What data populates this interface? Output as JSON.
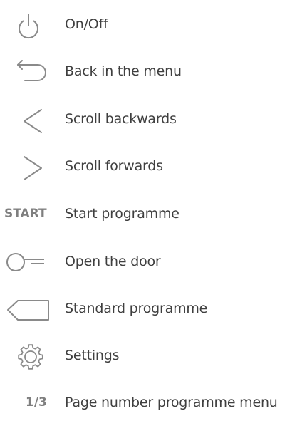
{
  "colors": {
    "icon": "#8a8a8a",
    "icon_text": "#7f7f7f",
    "label_text": "#3f3f3f",
    "background": "#ffffff"
  },
  "legend": {
    "items": [
      {
        "icon": "power-icon",
        "label": "On/Off"
      },
      {
        "icon": "back-arrow-icon",
        "label": "Back in the menu"
      },
      {
        "icon": "chevron-left-icon",
        "label": "Scroll backwards"
      },
      {
        "icon": "chevron-right-icon",
        "label": "Scroll forwards"
      },
      {
        "icon": "start-text-icon",
        "icon_text": "START",
        "label": "Start programme"
      },
      {
        "icon": "door-key-icon",
        "label": "Open the door"
      },
      {
        "icon": "tag-shape-icon",
        "label": "Standard programme"
      },
      {
        "icon": "gear-icon",
        "label": "Settings"
      },
      {
        "icon": "page-number-text-icon",
        "icon_text": "1/3",
        "label": "Page number programme menu"
      }
    ]
  }
}
